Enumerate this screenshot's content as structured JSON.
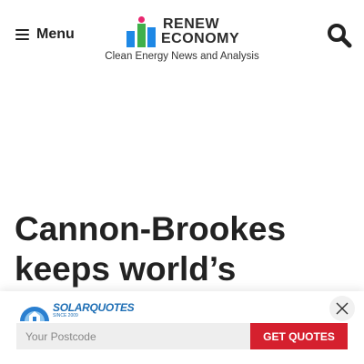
{
  "header": {
    "menu_label": "Menu",
    "logo_line1": "RENEW",
    "logo_line2": "ECONOMY",
    "tagline": "Clean Energy News and Analysis",
    "brand_colors": {
      "blue": "#1e88e5",
      "green": "#3fb04b",
      "pink": "#e9266f"
    }
  },
  "article": {
    "headline": "Cannon-Brookes keeps world’s"
  },
  "banner": {
    "brand_name": "SOLARQUOTES",
    "brand_since": "SINCE 2009",
    "postcode_placeholder": "Your Postcode",
    "cta_label": "GET QUOTES",
    "cta_color": "#d5202e"
  },
  "icons": {
    "menu": "hamburger-icon",
    "search": "search-icon",
    "close": "close-icon",
    "sun": "sun-house-icon"
  }
}
